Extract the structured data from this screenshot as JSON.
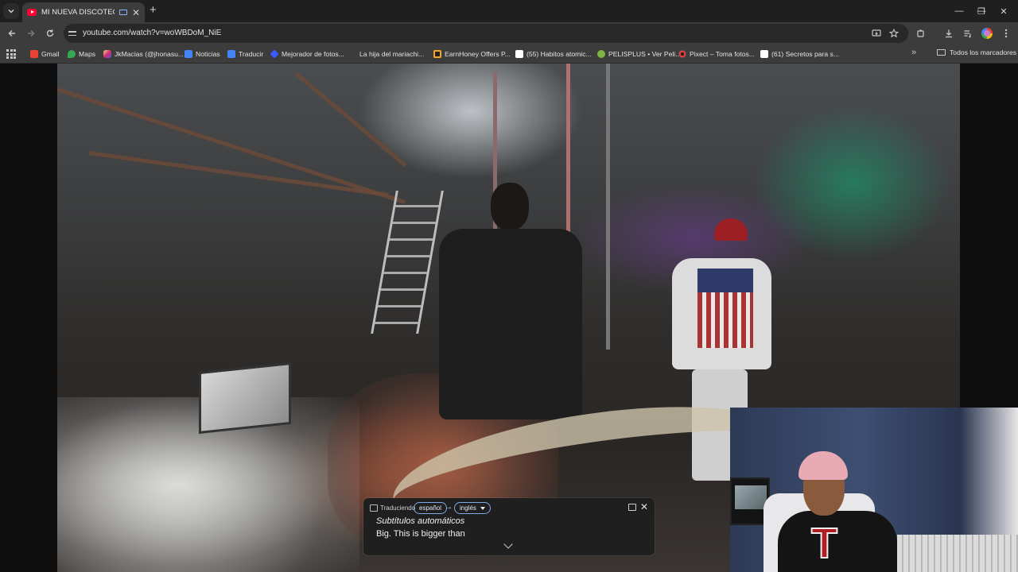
{
  "browser": {
    "tab": {
      "title": "MI NUEVA DISCOTECA | W"
    },
    "newtab_symbol": "+",
    "window_controls": [
      "—",
      "❐",
      "✕"
    ],
    "url": "youtube.com/watch?v=woWBDoM_NiE"
  },
  "bookmarks": {
    "items": [
      {
        "label": "Gmail",
        "color": "#ea4335"
      },
      {
        "label": "Maps",
        "color": "#34a853"
      },
      {
        "label": "JkMacias (@jhonasu...",
        "color": "#d62976"
      },
      {
        "label": "Noticias",
        "color": "#4285f4"
      },
      {
        "label": "Traducir",
        "color": "#4285f4"
      },
      {
        "label": "Mejorador de fotos...",
        "color": "#3d5afe"
      },
      {
        "label": "La hija del mariachi...",
        "color": "#9e9e9e"
      },
      {
        "label": "EarnHoney Offers P...",
        "color": "#f9a825"
      },
      {
        "label": "(55) Habitos atomic...",
        "color": "#ffffff"
      },
      {
        "label": "PELISPLUS • Ver Peli...",
        "color": "#7cb342"
      },
      {
        "label": "Pixect – Toma fotos...",
        "color": "#e53935"
      },
      {
        "label": "(61) Secretos para s...",
        "color": "#ffffff"
      }
    ],
    "more_symbol": "»",
    "all_bookmarks": "Todos los marcadores"
  },
  "captions": {
    "translating": "Traduciendo",
    "source_lang": "español",
    "arrow": "→",
    "target_lang": "inglés",
    "label": "Subtítulos automáticos",
    "text": "Big. This is bigger than",
    "close_symbol": "✕"
  }
}
